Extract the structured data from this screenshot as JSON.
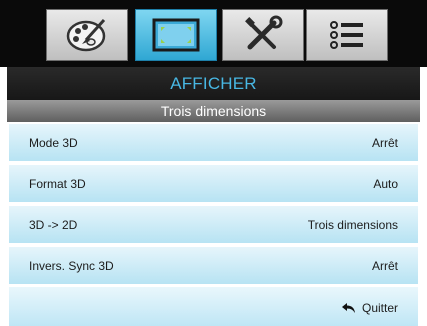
{
  "tabs": [
    {
      "icon": "palette-icon",
      "active": false
    },
    {
      "icon": "display-screen-icon",
      "active": true
    },
    {
      "icon": "tools-icon",
      "active": false
    },
    {
      "icon": "list-menu-icon",
      "active": false
    }
  ],
  "menu": {
    "title": "AFFICHER",
    "subtitle": "Trois dimensions"
  },
  "rows": [
    {
      "label": "Mode 3D",
      "value": "Arrêt"
    },
    {
      "label": "Format 3D",
      "value": "Auto"
    },
    {
      "label": "3D -> 2D",
      "value": "Trois dimensions"
    },
    {
      "label": "Invers. Sync 3D",
      "value": "Arrêt"
    }
  ],
  "footer": {
    "quit_label": "Quitter",
    "quit_icon": "return-arrow-icon"
  },
  "colors": {
    "title_text": "#48b7e3",
    "active_tab": "#2fa7d3",
    "row_bg": "#b7e3f3"
  }
}
